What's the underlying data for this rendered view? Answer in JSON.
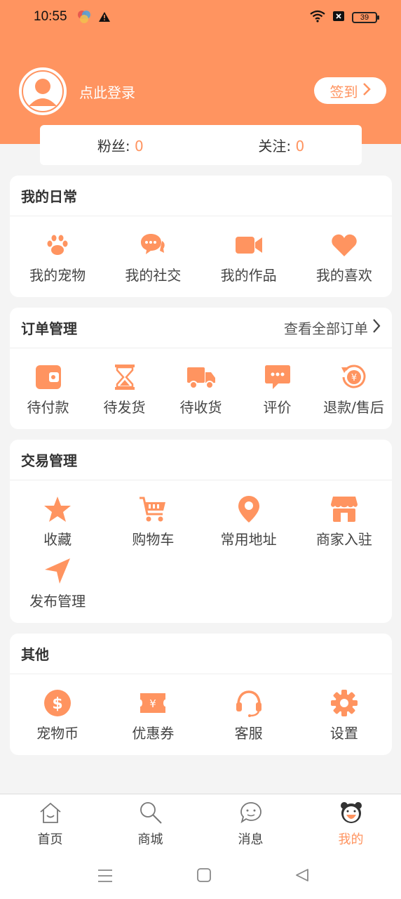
{
  "status": {
    "time": "10:55",
    "battery": "39"
  },
  "colors": {
    "accent": "#ff9460"
  },
  "profile": {
    "login_text": "点此登录",
    "checkin_label": "签到"
  },
  "stats": {
    "fans_label": "粉丝:",
    "fans_value": "0",
    "follow_label": "关注:",
    "follow_value": "0"
  },
  "daily": {
    "title": "我的日常",
    "items": [
      {
        "label": "我的宠物",
        "icon": "paw-icon"
      },
      {
        "label": "我的社交",
        "icon": "chat-bubbles-icon"
      },
      {
        "label": "我的作品",
        "icon": "video-camera-icon"
      },
      {
        "label": "我的喜欢",
        "icon": "heart-icon"
      }
    ]
  },
  "orders": {
    "title": "订单管理",
    "more_label": "查看全部订单",
    "items": [
      {
        "label": "待付款",
        "icon": "wallet-icon"
      },
      {
        "label": "待发货",
        "icon": "hourglass-icon"
      },
      {
        "label": "待收货",
        "icon": "truck-icon"
      },
      {
        "label": "评价",
        "icon": "comment-icon"
      },
      {
        "label": "退款/售后",
        "icon": "refund-icon"
      }
    ]
  },
  "trade": {
    "title": "交易管理",
    "items": [
      {
        "label": "收藏",
        "icon": "star-icon"
      },
      {
        "label": "购物车",
        "icon": "cart-icon"
      },
      {
        "label": "常用地址",
        "icon": "location-pin-icon"
      },
      {
        "label": "商家入驻",
        "icon": "store-icon"
      },
      {
        "label": "发布管理",
        "icon": "send-arrow-icon"
      }
    ]
  },
  "other": {
    "title": "其他",
    "items": [
      {
        "label": "宠物币",
        "icon": "dollar-coin-icon"
      },
      {
        "label": "优惠券",
        "icon": "coupon-icon"
      },
      {
        "label": "客服",
        "icon": "headset-icon"
      },
      {
        "label": "设置",
        "icon": "gear-icon"
      }
    ]
  },
  "tabbar": {
    "items": [
      {
        "label": "首页",
        "icon": "home-icon",
        "active": false
      },
      {
        "label": "商城",
        "icon": "search-icon",
        "active": false
      },
      {
        "label": "消息",
        "icon": "message-icon",
        "active": false
      },
      {
        "label": "我的",
        "icon": "bear-face-icon",
        "active": true
      }
    ]
  }
}
